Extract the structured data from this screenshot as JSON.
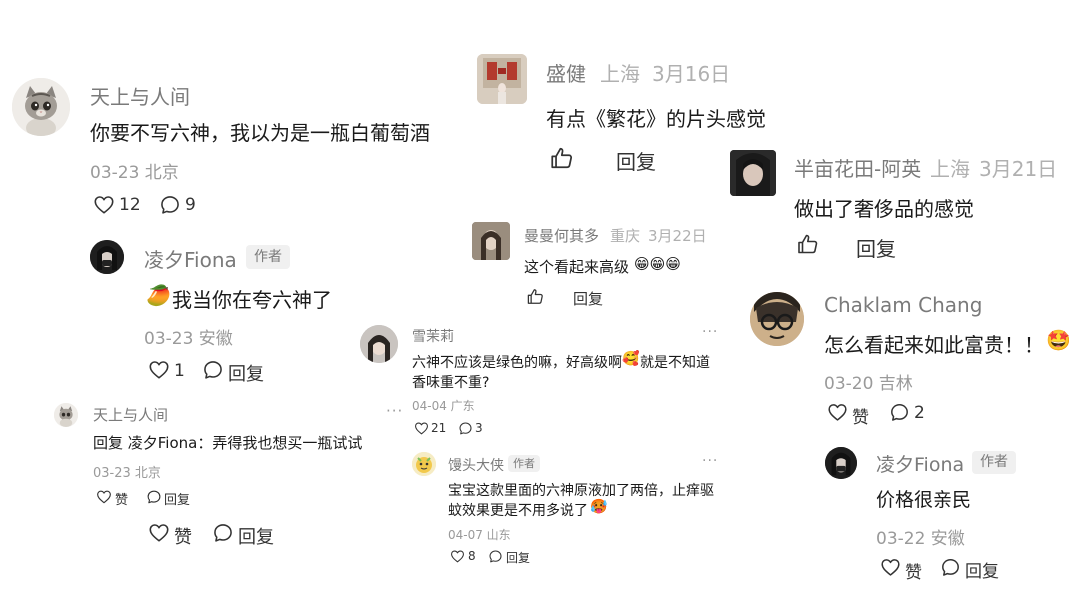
{
  "colors": {
    "text": "#1a1a1a",
    "name": "#7a7a7a",
    "meta": "#9a9a9a",
    "icon": "#333333"
  },
  "c1": {
    "user": "天上与人间",
    "text": "你要不写六神，我以为是一瓶白葡萄酒",
    "meta": "03-23 北京",
    "likes": "12",
    "replies": "9",
    "r1": {
      "user": "凌夕Fiona",
      "badge": "作者",
      "text": "我当你在夸六神了",
      "emoji": "🥭",
      "meta": "03-23 安徽",
      "likes": "1",
      "reply": "回复"
    },
    "r2": {
      "user": "天上与人间",
      "text": "回复 凌夕Fiona：弄得我也想买一瓶试试",
      "meta": "03-23 北京",
      "like": "赞",
      "reply": "回复",
      "more": "···"
    },
    "bottom": {
      "like": "赞",
      "reply": "回复"
    }
  },
  "c2": {
    "user": "盛健",
    "loc": "上海",
    "date": "3月16日",
    "text": "有点《繁花》的片头感觉",
    "reply": "回复"
  },
  "c3": {
    "user": "半亩花田-阿英",
    "loc": "上海",
    "date": "3月21日",
    "text": "做出了奢侈品的感觉",
    "reply": "回复"
  },
  "c4": {
    "user": "曼曼何其多",
    "loc": "重庆",
    "date": "3月22日",
    "text": "这个看起来高级",
    "emoji": "😁😁😁",
    "reply": "回复"
  },
  "c5": {
    "user": "雪茉莉",
    "text1": "六神不应该是绿色的嘛，好高级啊",
    "emoji": "🥰",
    "text1b": "就是不知道",
    "text2": "香味重不重?",
    "meta": "04-04 广东",
    "likes": "21",
    "replies": "3",
    "more": "···"
  },
  "c6": {
    "user": "馒头大侠",
    "badge": "作者",
    "text1": "宝宝这款里面的六神原液加了两倍，止痒驱",
    "text2": "蚊效果更是不用多说了",
    "emoji": "🥵",
    "meta": "04-07 山东",
    "likes": "8",
    "reply": "回复",
    "more": "···"
  },
  "c7": {
    "user": "Chaklam Chang",
    "text": "怎么看起来如此富贵！！",
    "emoji": "🤩",
    "meta": "03-20 吉林",
    "like": "赞",
    "replies": "2",
    "r1": {
      "user": "凌夕Fiona",
      "badge": "作者",
      "text": "价格很亲民",
      "meta": "03-22 安徽",
      "like": "赞",
      "reply": "回复"
    }
  }
}
